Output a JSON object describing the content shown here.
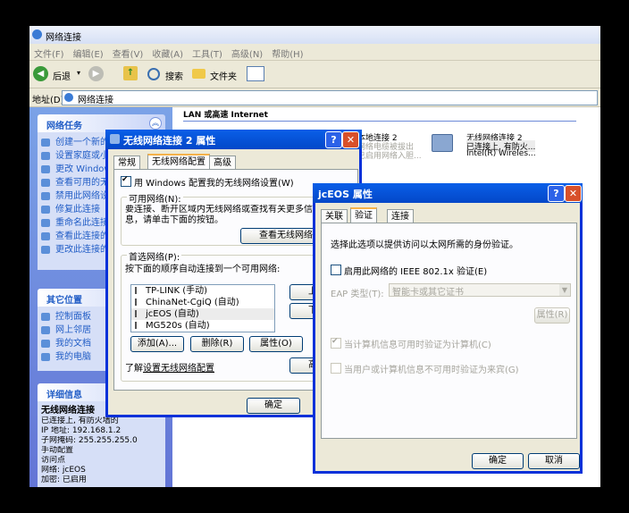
{
  "explorer": {
    "title": "网络连接",
    "menu": [
      "文件(F)",
      "编辑(E)",
      "查看(V)",
      "收藏(A)",
      "工具(T)",
      "高级(N)",
      "帮助(H)"
    ],
    "toolbar": {
      "back": "后退",
      "search": "搜索",
      "folders": "文件夹"
    },
    "address_label": "地址(D)",
    "address_value": "网络连接",
    "section_header": "LAN 或高速 Internet",
    "conn1": {
      "name": "本地连接 2",
      "status": "网络电缆被拔出",
      "detail": "已启用网络入胆..."
    },
    "conn2": {
      "name": "无线网络连接 2",
      "status": "已连接上, 有防火...",
      "detail": "Intel(R) Wireles..."
    }
  },
  "left_pane": {
    "tasks_title": "网络任务",
    "tasks": [
      "创建一个新的连接",
      "设置家庭或小型办公网络",
      "更改 Windows 防火墙设置",
      "查看可用的无线网络",
      "禁用此网络设备",
      "修复此连接",
      "重命名此连接",
      "查看此连接的状态",
      "更改此连接的设置"
    ],
    "other_title": "其它位置",
    "other": [
      "控制面板",
      "网上邻居",
      "我的文档",
      "我的电脑"
    ],
    "details_title": "详细信息",
    "details_name": "无线网络连接",
    "details_lines": [
      "已连接上, 有防火墙的",
      "IP 地址: 192.168.1.2",
      "子网掩码: 255.255.255.0",
      "手动配置",
      "访问点",
      "网络: jcEOS",
      "加密: 已启用"
    ]
  },
  "wireless_dialog": {
    "title": "无线网络连接 2 属性",
    "tabs": [
      "常规",
      "无线网络配置",
      "高级"
    ],
    "use_windows_label": "用 Windows 配置我的无线网络设置(W)",
    "available_group": "可用网络(N):",
    "available_desc": "要连接、断开区域内无线网络或查找有关更多信息，请单击下面的按钮。",
    "view_button": "查看无线网络",
    "preferred_group": "首选网络(P):",
    "preferred_desc": "按下面的顺序自动连接到一个可用网络:",
    "networks": [
      "TP-LINK (手动)",
      "ChinaNet-CgiQ (自动)",
      "jcEOS (自动)",
      "MG520s (自动)"
    ],
    "up_button": "上移",
    "down_button": "下移",
    "add_button": "添加(A)...",
    "remove_button": "删除(R)",
    "props_button": "属性(O)",
    "learn_prefix": "了解",
    "learn_link": "设置无线网络配置",
    "advanced_button": "高级",
    "ok_button": "确定"
  },
  "jceos_dialog": {
    "title": "jcEOS 属性",
    "tabs": [
      "关联",
      "验证",
      "连接"
    ],
    "description": "选择此选项以提供访问以太网所需的身份验证。",
    "enable_8021x": "启用此网络的 IEEE 802.1x 验证(E)",
    "eap_label": "EAP 类型(T):",
    "eap_value": "智能卡或其它证书",
    "properties_button": "属性(R)",
    "computer_auth": "当计算机信息可用时验证为计算机(C)",
    "guest_auth": "当用户或计算机信息不可用时验证为来宾(G)",
    "ok_button": "确定",
    "cancel_button": "取消"
  }
}
